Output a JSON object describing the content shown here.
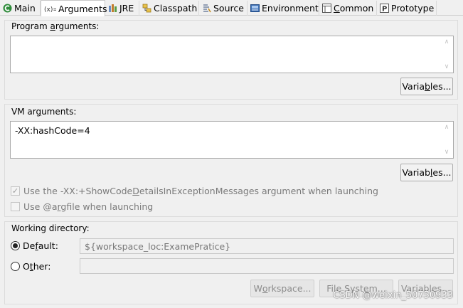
{
  "tabs": [
    {
      "label": "Main",
      "icon": "main-icon",
      "active": false
    },
    {
      "label": "Arguments",
      "icon": "arguments-icon",
      "active": true
    },
    {
      "label": "JRE",
      "icon": "jre-icon",
      "active": false
    },
    {
      "label": "Classpath",
      "icon": "classpath-icon",
      "active": false
    },
    {
      "label": "Source",
      "icon": "source-icon",
      "active": false
    },
    {
      "label": "Environment",
      "icon": "environment-icon",
      "active": false
    },
    {
      "label": "Common",
      "icon": "common-icon",
      "active": false
    },
    {
      "label": "Prototype",
      "icon": "prototype-icon",
      "active": false
    }
  ],
  "program_args": {
    "label": "Program arguments:",
    "value": "",
    "variables_label": "Variables..."
  },
  "vm_args": {
    "label": "VM arguments:",
    "value": "-XX:hashCode=4",
    "variables_label": "Variables...",
    "show_code_details": {
      "label": "Use the -XX:+ShowCodeDetailsInExceptionMessages argument when launching",
      "checked": true
    },
    "argfile": {
      "label": "Use @argfile when launching",
      "checked": false
    }
  },
  "working_dir": {
    "label": "Working directory:",
    "default_label": "Default:",
    "default_value": "${workspace_loc:ExamePratice}",
    "default_selected": true,
    "other_label": "Other:",
    "other_value": "",
    "workspace_label": "Workspace...",
    "filesystem_label": "File System...",
    "variables_label": "Variables..."
  },
  "watermark": "CSDN @weixin_50750933"
}
